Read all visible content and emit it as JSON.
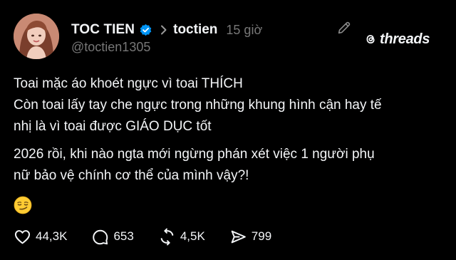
{
  "post": {
    "display_name": "TOC TIEN",
    "verified": true,
    "username": "toctien",
    "time_ago": "15 giờ",
    "handle": "@toctien1305",
    "brand": "threads",
    "lines": [
      "Toai mặc áo khoét ngực vì toai THÍCH",
      "Còn toai lấy tay che ngực trong những khung hình cận hay tế",
      "nhị là vì toai được GIÁO DỤC tốt"
    ],
    "lines2": [
      "2026 rồi, khi nào ngta mới ngừng phán xét việc 1 người phụ",
      "nữ bảo vệ chính cơ thể của mình vậy?!"
    ],
    "emoji": "smirking-face"
  },
  "actions": {
    "likes": "44,3K",
    "replies": "653",
    "reposts": "4,5K",
    "shares": "799"
  },
  "colors": {
    "background": "#000000",
    "text": "#f3f5f7",
    "muted": "#777777",
    "verified": "#0095f6"
  }
}
